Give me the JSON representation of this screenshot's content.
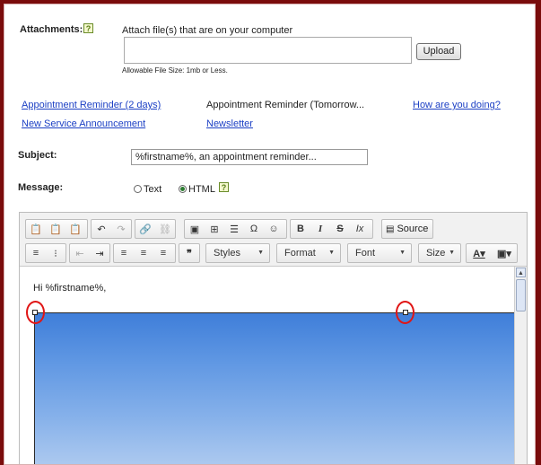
{
  "attachments": {
    "label": "Attachments:",
    "help": "?",
    "caption": "Attach file(s) that are on your computer",
    "upload_label": "Upload",
    "note": "Allowable File Size: 1mb or Less."
  },
  "templates": {
    "row1": [
      "Appointment Reminder (2 days)",
      "Appointment Reminder (Tomorrow...",
      "How are you doing?"
    ],
    "row2": [
      "New Service Announcement",
      "Newsletter"
    ]
  },
  "subject": {
    "label": "Subject:",
    "value": "%firstname%, an appointment reminder..."
  },
  "message": {
    "label": "Message:",
    "options": [
      "Text",
      "HTML"
    ],
    "selected": "HTML",
    "help": "?"
  },
  "editor": {
    "toolbar_row1_icons": [
      "paste-icon",
      "paste-text-icon",
      "paste-word-icon",
      "undo-icon",
      "redo-icon",
      "link-icon",
      "unlink-icon",
      "image-icon",
      "table-icon",
      "horizontal-rule-icon",
      "special-char-icon",
      "smiley-icon",
      "bold-icon",
      "italic-icon",
      "strike-icon",
      "remove-format-icon",
      "source-icon"
    ],
    "source_label": "Source",
    "combos": {
      "styles": "Styles",
      "format": "Format",
      "font": "Font",
      "size": "Size"
    },
    "content_text": "Hi %firstname%,",
    "glyphs": {
      "bold": "B",
      "italic": "I",
      "strike": "S",
      "clear": "Ix",
      "omega": "Ω",
      "smiley": "☺",
      "quote": "❞"
    }
  },
  "colors": {
    "frame": "#7a0c0c",
    "link": "#1b3fc4",
    "highlight": "#e01515"
  }
}
